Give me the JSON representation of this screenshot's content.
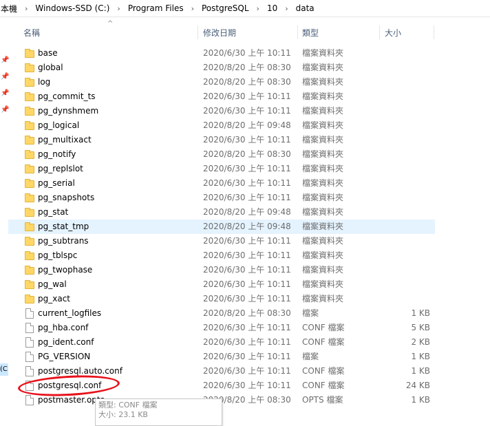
{
  "breadcrumb": {
    "items": [
      "本機",
      "Windows-SSD (C:)",
      "Program Files",
      "PostgreSQL",
      "10",
      "data"
    ],
    "separator": "›"
  },
  "nav_pane": {
    "drive_label": "(C:)"
  },
  "columns": {
    "name": "名稱",
    "modified": "修改日期",
    "type": "類型",
    "size": "大小"
  },
  "files": [
    {
      "name": "base",
      "date": "2020/6/30 上午 10:11",
      "type": "檔案資料夾",
      "size": "",
      "kind": "folder"
    },
    {
      "name": "global",
      "date": "2020/8/20 上午 08:30",
      "type": "檔案資料夾",
      "size": "",
      "kind": "folder"
    },
    {
      "name": "log",
      "date": "2020/8/20 上午 08:30",
      "type": "檔案資料夾",
      "size": "",
      "kind": "folder"
    },
    {
      "name": "pg_commit_ts",
      "date": "2020/6/30 上午 10:11",
      "type": "檔案資料夾",
      "size": "",
      "kind": "folder"
    },
    {
      "name": "pg_dynshmem",
      "date": "2020/6/30 上午 10:11",
      "type": "檔案資料夾",
      "size": "",
      "kind": "folder"
    },
    {
      "name": "pg_logical",
      "date": "2020/8/20 上午 09:48",
      "type": "檔案資料夾",
      "size": "",
      "kind": "folder"
    },
    {
      "name": "pg_multixact",
      "date": "2020/6/30 上午 10:11",
      "type": "檔案資料夾",
      "size": "",
      "kind": "folder"
    },
    {
      "name": "pg_notify",
      "date": "2020/8/20 上午 08:30",
      "type": "檔案資料夾",
      "size": "",
      "kind": "folder"
    },
    {
      "name": "pg_replslot",
      "date": "2020/6/30 上午 10:11",
      "type": "檔案資料夾",
      "size": "",
      "kind": "folder"
    },
    {
      "name": "pg_serial",
      "date": "2020/6/30 上午 10:11",
      "type": "檔案資料夾",
      "size": "",
      "kind": "folder"
    },
    {
      "name": "pg_snapshots",
      "date": "2020/6/30 上午 10:11",
      "type": "檔案資料夾",
      "size": "",
      "kind": "folder"
    },
    {
      "name": "pg_stat",
      "date": "2020/8/20 上午 09:48",
      "type": "檔案資料夾",
      "size": "",
      "kind": "folder"
    },
    {
      "name": "pg_stat_tmp",
      "date": "2020/8/20 上午 09:48",
      "type": "檔案資料夾",
      "size": "",
      "kind": "folder",
      "hover": true
    },
    {
      "name": "pg_subtrans",
      "date": "2020/6/30 上午 10:11",
      "type": "檔案資料夾",
      "size": "",
      "kind": "folder"
    },
    {
      "name": "pg_tblspc",
      "date": "2020/6/30 上午 10:11",
      "type": "檔案資料夾",
      "size": "",
      "kind": "folder"
    },
    {
      "name": "pg_twophase",
      "date": "2020/6/30 上午 10:11",
      "type": "檔案資料夾",
      "size": "",
      "kind": "folder"
    },
    {
      "name": "pg_wal",
      "date": "2020/6/30 上午 10:11",
      "type": "檔案資料夾",
      "size": "",
      "kind": "folder"
    },
    {
      "name": "pg_xact",
      "date": "2020/6/30 上午 10:11",
      "type": "檔案資料夾",
      "size": "",
      "kind": "folder"
    },
    {
      "name": "current_logfiles",
      "date": "2020/8/20 上午 08:30",
      "type": "檔案",
      "size": "1 KB",
      "kind": "file"
    },
    {
      "name": "pg_hba.conf",
      "date": "2020/6/30 上午 10:11",
      "type": "CONF 檔案",
      "size": "5 KB",
      "kind": "file"
    },
    {
      "name": "pg_ident.conf",
      "date": "2020/6/30 上午 10:11",
      "type": "CONF 檔案",
      "size": "2 KB",
      "kind": "file"
    },
    {
      "name": "PG_VERSION",
      "date": "2020/6/30 上午 10:11",
      "type": "檔案",
      "size": "1 KB",
      "kind": "file"
    },
    {
      "name": "postgresql.auto.conf",
      "date": "2020/6/30 上午 10:11",
      "type": "CONF 檔案",
      "size": "1 KB",
      "kind": "file"
    },
    {
      "name": "postgresql.conf",
      "date": "2020/6/30 上午 10:11",
      "type": "CONF 檔案",
      "size": "24 KB",
      "kind": "file",
      "highlighted": true
    },
    {
      "name": "postmaster.opts",
      "date": "2020/8/20 上午 08:30",
      "type": "OPTS 檔案",
      "size": "1 KB",
      "kind": "file"
    }
  ],
  "tooltip": {
    "line1": "類型: CONF 檔案",
    "line2": "大小: 23.1 KB"
  },
  "colors": {
    "hover_row": "#e5f3ff",
    "annotation": "#e8111b",
    "header_text": "#4c607a"
  }
}
